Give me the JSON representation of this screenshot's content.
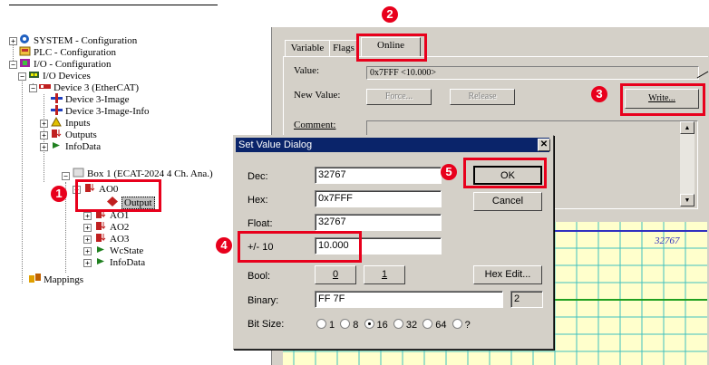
{
  "tree": {
    "items": [
      {
        "label": "SYSTEM - Configuration",
        "icon": "system-icon",
        "color": "#2060c0"
      },
      {
        "label": "PLC - Configuration",
        "icon": "plc-icon",
        "color": "#d08000"
      },
      {
        "label": "I/O - Configuration",
        "icon": "io-config-icon",
        "color": "#a020a0"
      },
      {
        "label": "I/O Devices",
        "icon": "io-devices-icon",
        "color": "#306030"
      },
      {
        "label": "Device 3 (EtherCAT)",
        "icon": "ethercat-device-icon",
        "color": "#c02020"
      },
      {
        "label": "Device 3-Image",
        "icon": "image-icon",
        "color": "#2040c0"
      },
      {
        "label": "Device 3-Image-Info",
        "icon": "image-info-icon",
        "color": "#2040c0"
      },
      {
        "label": "Inputs",
        "icon": "inputs-icon",
        "color": "#c0a000"
      },
      {
        "label": "Outputs",
        "icon": "outputs-icon",
        "color": "#c02020"
      },
      {
        "label": "InfoData",
        "icon": "infodata-icon",
        "color": "#208020"
      },
      {
        "label": "Box 1 (ECAT-2024 4 Ch. Ana.)",
        "icon": "box-icon",
        "color": "#808080"
      },
      {
        "label": "AO0",
        "icon": "ao-icon",
        "color": "#c02020"
      },
      {
        "label": "Output",
        "icon": "output-var-icon",
        "color": "#c02020"
      },
      {
        "label": "AO1",
        "icon": "ao-icon",
        "color": "#c02020"
      },
      {
        "label": "AO2",
        "icon": "ao-icon",
        "color": "#c02020"
      },
      {
        "label": "AO3",
        "icon": "ao-icon",
        "color": "#c02020"
      },
      {
        "label": "WcState",
        "icon": "wcstate-icon",
        "color": "#208020"
      },
      {
        "label": "InfoData",
        "icon": "infodata-icon",
        "color": "#208020"
      },
      {
        "label": "Mappings",
        "icon": "mappings-icon",
        "color": "#c08000"
      }
    ]
  },
  "panel": {
    "tabs": [
      "Variable",
      "Flags",
      "Online"
    ],
    "value_label": "Value:",
    "value": "0x7FFF <10.000>",
    "new_value_label": "New Value:",
    "force_label": "Force...",
    "release_label": "Release",
    "write_label": "Write...",
    "comment_label": "Comment:",
    "chart_value": "32767"
  },
  "dialog": {
    "title": "Set Value Dialog",
    "dec_label": "Dec:",
    "dec_value": "32767",
    "hex_label": "Hex:",
    "hex_value": "0x7FFF",
    "float_label": "Float:",
    "float_value": "32767",
    "range_label": "+/- 10",
    "range_value": "10.000",
    "bool_label": "Bool:",
    "bool_0": "0",
    "bool_1": "1",
    "hex_edit_label": "Hex Edit...",
    "binary_label": "Binary:",
    "binary_value": "FF 7F",
    "binary_count": "2",
    "bitsize_label": "Bit Size:",
    "bitsizes": [
      "1",
      "8",
      "16",
      "32",
      "64",
      "?"
    ],
    "bitsize_selected": "16",
    "ok_label": "OK",
    "cancel_label": "Cancel"
  },
  "annotations": {
    "badges": [
      "1",
      "2",
      "3",
      "4",
      "5"
    ],
    "highlight_color": "#e8001c"
  }
}
